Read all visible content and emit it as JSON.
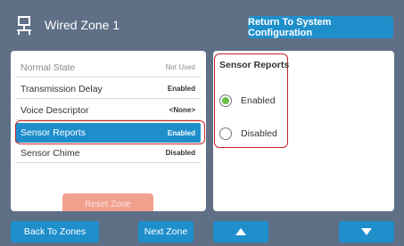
{
  "header": {
    "title": "Wired Zone 1",
    "icon": "network-icon",
    "return_label": "Return To System Configuration"
  },
  "settings": [
    {
      "label": "Normal State",
      "value": "Not Used"
    },
    {
      "label": "Transmission Delay",
      "value": "Enabled"
    },
    {
      "label": "Voice Descriptor",
      "value": "<None>"
    },
    {
      "label": "Sensor Reports",
      "value": "Enabled"
    },
    {
      "label": "Sensor Chime",
      "value": "Disabled"
    }
  ],
  "reset_label": "Reset Zone",
  "detail": {
    "title": "Sensor Reports",
    "options": [
      {
        "label": "Enabled",
        "selected": true
      },
      {
        "label": "Disabled",
        "selected": false
      }
    ]
  },
  "bottom": {
    "back_label": "Back To Zones",
    "next_label": "Next Zone",
    "up_icon": "arrow-up-icon",
    "down_icon": "arrow-down-icon"
  },
  "colors": {
    "background": "#5f6f86",
    "accent": "#1f8fcc",
    "highlight": "#c82323",
    "radio_on": "#6cc04a"
  }
}
